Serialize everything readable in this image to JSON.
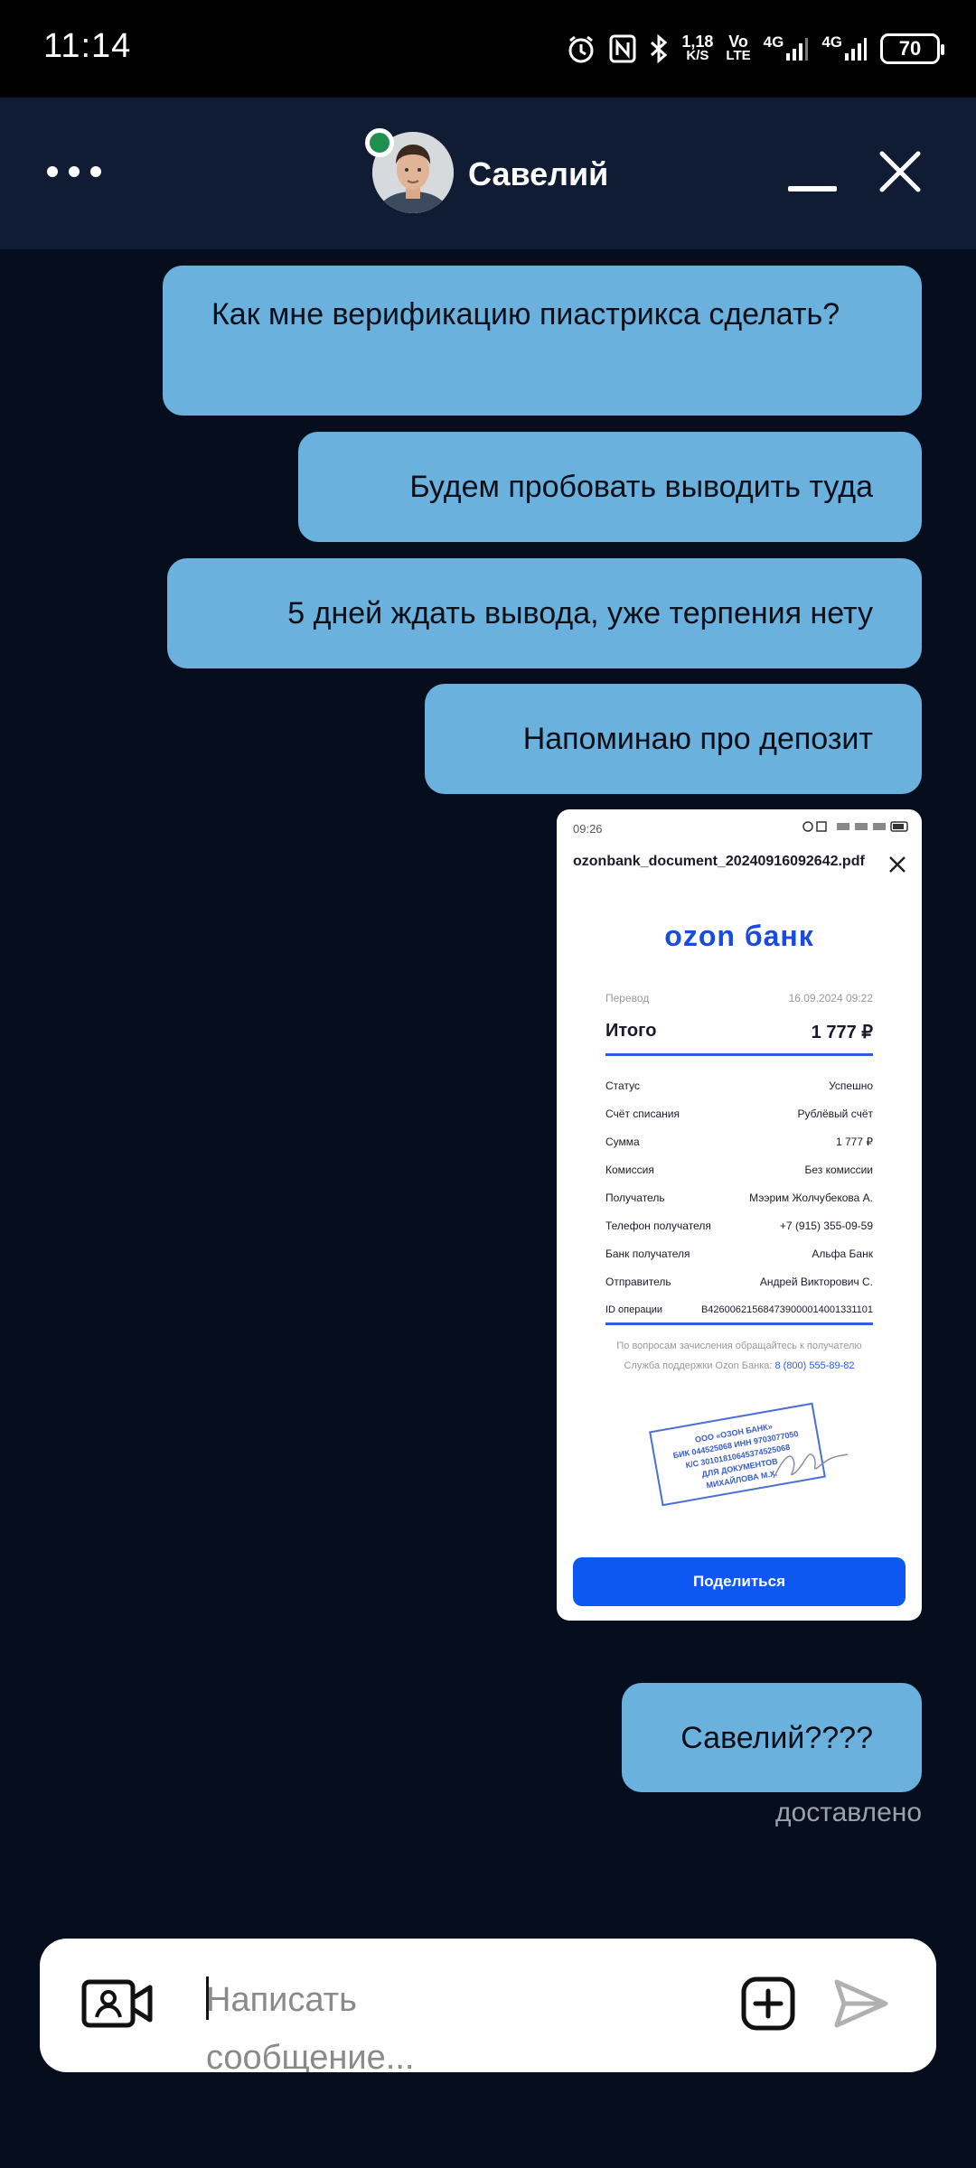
{
  "status_bar": {
    "time": "11:14",
    "net_speed_top": "1,18",
    "net_speed_unit": "K/S",
    "volte_top": "Vo",
    "volte_bottom": "LTE",
    "sim1_label": "4G",
    "sim2_label": "4G",
    "battery": "70"
  },
  "header": {
    "contact_name": "Савелий",
    "online": true
  },
  "messages": [
    {
      "text": "Как мне верификацию пиастрикса сделать?"
    },
    {
      "text": "Будем пробовать выводить туда"
    },
    {
      "text": "5 дней ждать вывода, уже терпения нету"
    },
    {
      "text": "Напоминаю про депозит"
    },
    {
      "text": "Савелий????"
    }
  ],
  "delivery_status": "доставлено",
  "receipt": {
    "status_time": "09:26",
    "filename": "ozonbank_document_20240916092642.pdf",
    "logo": "ozon банк",
    "type_label": "Перевод",
    "datetime": "16.09.2024 09:22",
    "total_label": "Итого",
    "total_value": "1 777 ₽",
    "rows": [
      {
        "label": "Статус",
        "value": "Успешно"
      },
      {
        "label": "Счёт списания",
        "value": "Рублёвый счёт"
      },
      {
        "label": "Сумма",
        "value": "1 777 ₽"
      },
      {
        "label": "Комиссия",
        "value": "Без комиссии"
      },
      {
        "label": "Получатель",
        "value": "Мээрим Жолчубекова А."
      },
      {
        "label": "Телефон получателя",
        "value": "+7 (915) 355-09-59"
      },
      {
        "label": "Банк получателя",
        "value": "Альфа Банк"
      },
      {
        "label": "Отправитель",
        "value": "Андрей Викторович С."
      },
      {
        "label": "ID операции",
        "value": "B426006215684739000014001331101"
      }
    ],
    "note_line1": "По вопросам зачисления обращайтесь к получателю",
    "note_line2_prefix": "Служба поддержки Ozon Банка: ",
    "note_phone": "8 (800) 555-89-82",
    "stamp_lines": [
      "ООО «ОЗОН БАНК»",
      "БИК 044525068 ИНН 9703077050",
      "К/С 30101810645374525068",
      "ДЛЯ ДОКУМЕНТОВ",
      "МИХАЙЛОВА М.Х."
    ],
    "share_button": "Поделиться"
  },
  "input": {
    "placeholder": "Написать сообщение..."
  },
  "icons": {
    "video": "video-camera-icon",
    "attach": "plus-square-icon",
    "send": "send-icon",
    "menu": "more-horizontal-icon",
    "close": "close-icon",
    "minimize": "minimize-icon"
  }
}
